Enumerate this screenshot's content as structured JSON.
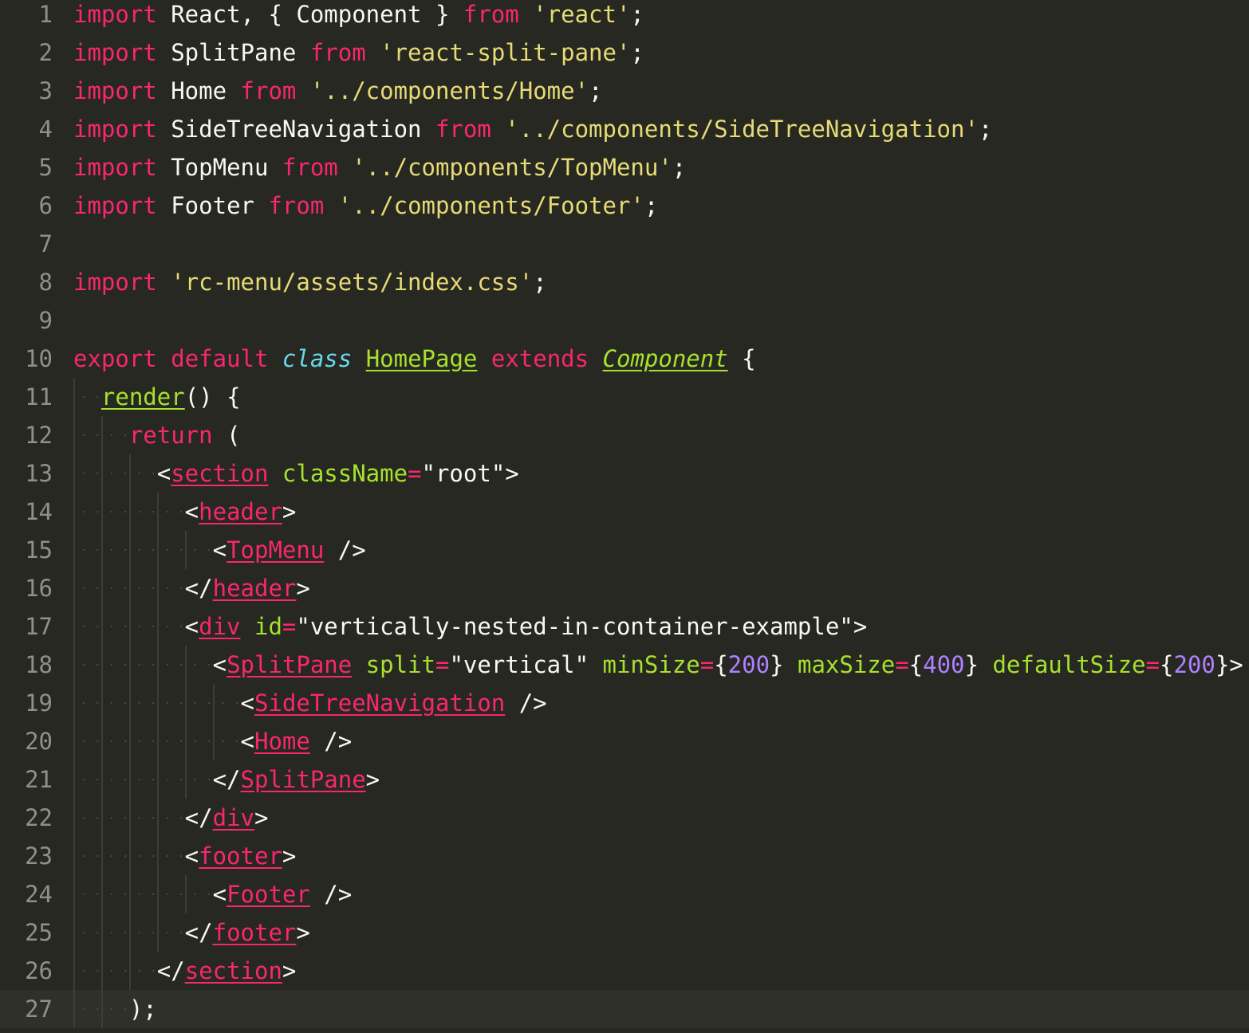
{
  "editor": {
    "theme_colors": {
      "background": "#272822",
      "current_line": "#2f3029",
      "line_number": "#8f908a",
      "keyword": "#f92672",
      "string": "#e6db74",
      "storage_type": "#66d9ef",
      "entity": "#a6e22e",
      "number": "#ae81ff",
      "plain": "#f8f8f2"
    },
    "current_line": 27,
    "lines": [
      {
        "num": "1",
        "tokens": [
          [
            "kw",
            "import"
          ],
          [
            "pn",
            " React, { Component } "
          ],
          [
            "kw",
            "from"
          ],
          [
            "pn",
            " "
          ],
          [
            "st",
            "'react'"
          ],
          [
            "pn",
            ";"
          ]
        ]
      },
      {
        "num": "2",
        "tokens": [
          [
            "kw",
            "import"
          ],
          [
            "pn",
            " SplitPane "
          ],
          [
            "kw",
            "from"
          ],
          [
            "pn",
            " "
          ],
          [
            "st",
            "'react-split-pane'"
          ],
          [
            "pn",
            ";"
          ]
        ]
      },
      {
        "num": "3",
        "tokens": [
          [
            "kw",
            "import"
          ],
          [
            "pn",
            " Home "
          ],
          [
            "kw",
            "from"
          ],
          [
            "pn",
            " "
          ],
          [
            "st",
            "'../components/Home'"
          ],
          [
            "pn",
            ";"
          ]
        ]
      },
      {
        "num": "4",
        "tokens": [
          [
            "kw",
            "import"
          ],
          [
            "pn",
            " SideTreeNavigation "
          ],
          [
            "kw",
            "from"
          ],
          [
            "pn",
            " "
          ],
          [
            "st",
            "'../components/SideTreeNavigation'"
          ],
          [
            "pn",
            ";"
          ]
        ]
      },
      {
        "num": "5",
        "tokens": [
          [
            "kw",
            "import"
          ],
          [
            "pn",
            " TopMenu "
          ],
          [
            "kw",
            "from"
          ],
          [
            "pn",
            " "
          ],
          [
            "st",
            "'../components/TopMenu'"
          ],
          [
            "pn",
            ";"
          ]
        ]
      },
      {
        "num": "6",
        "tokens": [
          [
            "kw",
            "import"
          ],
          [
            "pn",
            " Footer "
          ],
          [
            "kw",
            "from"
          ],
          [
            "pn",
            " "
          ],
          [
            "st",
            "'../components/Footer'"
          ],
          [
            "pn",
            ";"
          ]
        ]
      },
      {
        "num": "7",
        "tokens": []
      },
      {
        "num": "8",
        "tokens": [
          [
            "kw",
            "import"
          ],
          [
            "pn",
            " "
          ],
          [
            "st",
            "'rc-menu/assets/index.css'"
          ],
          [
            "pn",
            ";"
          ]
        ]
      },
      {
        "num": "9",
        "tokens": []
      },
      {
        "num": "10",
        "tokens": [
          [
            "kw",
            "export"
          ],
          [
            "pn",
            " "
          ],
          [
            "kw",
            "default"
          ],
          [
            "pn",
            " "
          ],
          [
            "ty",
            "class"
          ],
          [
            "pn",
            " "
          ],
          [
            "fn",
            "HomePage"
          ],
          [
            "pn",
            " "
          ],
          [
            "kw",
            "extends"
          ],
          [
            "pn",
            " "
          ],
          [
            "inh",
            "Component"
          ],
          [
            "pn",
            " {"
          ]
        ]
      },
      {
        "num": "11",
        "tokens": [
          [
            "pn",
            "  "
          ],
          [
            "fn",
            "render"
          ],
          [
            "pn",
            "() {"
          ]
        ]
      },
      {
        "num": "12",
        "tokens": [
          [
            "pn",
            "    "
          ],
          [
            "kw",
            "return"
          ],
          [
            "pn",
            " ("
          ]
        ]
      },
      {
        "num": "13",
        "tokens": [
          [
            "pn",
            "      <"
          ],
          [
            "tag",
            "section"
          ],
          [
            "pn",
            " "
          ],
          [
            "at",
            "className"
          ],
          [
            "kw",
            "="
          ],
          [
            "pn",
            "\"root\">"
          ]
        ]
      },
      {
        "num": "14",
        "tokens": [
          [
            "pn",
            "        <"
          ],
          [
            "tag",
            "header"
          ],
          [
            "pn",
            ">"
          ]
        ]
      },
      {
        "num": "15",
        "tokens": [
          [
            "pn",
            "          <"
          ],
          [
            "tag",
            "TopMenu"
          ],
          [
            "pn",
            " />"
          ]
        ]
      },
      {
        "num": "16",
        "tokens": [
          [
            "pn",
            "        </"
          ],
          [
            "tag",
            "header"
          ],
          [
            "pn",
            ">"
          ]
        ]
      },
      {
        "num": "17",
        "tokens": [
          [
            "pn",
            "        <"
          ],
          [
            "tag",
            "div"
          ],
          [
            "pn",
            " "
          ],
          [
            "at",
            "id"
          ],
          [
            "kw",
            "="
          ],
          [
            "pn",
            "\"vertically-nested-in-container-example\">"
          ]
        ]
      },
      {
        "num": "18",
        "tokens": [
          [
            "pn",
            "          <"
          ],
          [
            "tag",
            "SplitPane"
          ],
          [
            "pn",
            " "
          ],
          [
            "at",
            "split"
          ],
          [
            "kw",
            "="
          ],
          [
            "pn",
            "\"vertical\" "
          ],
          [
            "at",
            "minSize"
          ],
          [
            "kw",
            "="
          ],
          [
            "pn",
            "{"
          ],
          [
            "nu",
            "200"
          ],
          [
            "pn",
            "} "
          ],
          [
            "at",
            "maxSize"
          ],
          [
            "kw",
            "="
          ],
          [
            "pn",
            "{"
          ],
          [
            "nu",
            "400"
          ],
          [
            "pn",
            "} "
          ],
          [
            "at",
            "defaultSize"
          ],
          [
            "kw",
            "="
          ],
          [
            "pn",
            "{"
          ],
          [
            "nu",
            "200"
          ],
          [
            "pn",
            "}>"
          ]
        ]
      },
      {
        "num": "19",
        "tokens": [
          [
            "pn",
            "            <"
          ],
          [
            "tag",
            "SideTreeNavigation"
          ],
          [
            "pn",
            " />"
          ]
        ]
      },
      {
        "num": "20",
        "tokens": [
          [
            "pn",
            "            <"
          ],
          [
            "tag",
            "Home"
          ],
          [
            "pn",
            " />"
          ]
        ]
      },
      {
        "num": "21",
        "tokens": [
          [
            "pn",
            "          </"
          ],
          [
            "tag",
            "SplitPane"
          ],
          [
            "pn",
            ">"
          ]
        ]
      },
      {
        "num": "22",
        "tokens": [
          [
            "pn",
            "        </"
          ],
          [
            "tag",
            "div"
          ],
          [
            "pn",
            ">"
          ]
        ]
      },
      {
        "num": "23",
        "tokens": [
          [
            "pn",
            "        <"
          ],
          [
            "tag",
            "footer"
          ],
          [
            "pn",
            ">"
          ]
        ]
      },
      {
        "num": "24",
        "tokens": [
          [
            "pn",
            "          <"
          ],
          [
            "tag",
            "Footer"
          ],
          [
            "pn",
            " />"
          ]
        ]
      },
      {
        "num": "25",
        "tokens": [
          [
            "pn",
            "        </"
          ],
          [
            "tag",
            "footer"
          ],
          [
            "pn",
            ">"
          ]
        ]
      },
      {
        "num": "26",
        "tokens": [
          [
            "pn",
            "      </"
          ],
          [
            "tag",
            "section"
          ],
          [
            "pn",
            ">"
          ]
        ]
      },
      {
        "num": "27",
        "tokens": [
          [
            "pn",
            "    );"
          ]
        ]
      }
    ]
  }
}
